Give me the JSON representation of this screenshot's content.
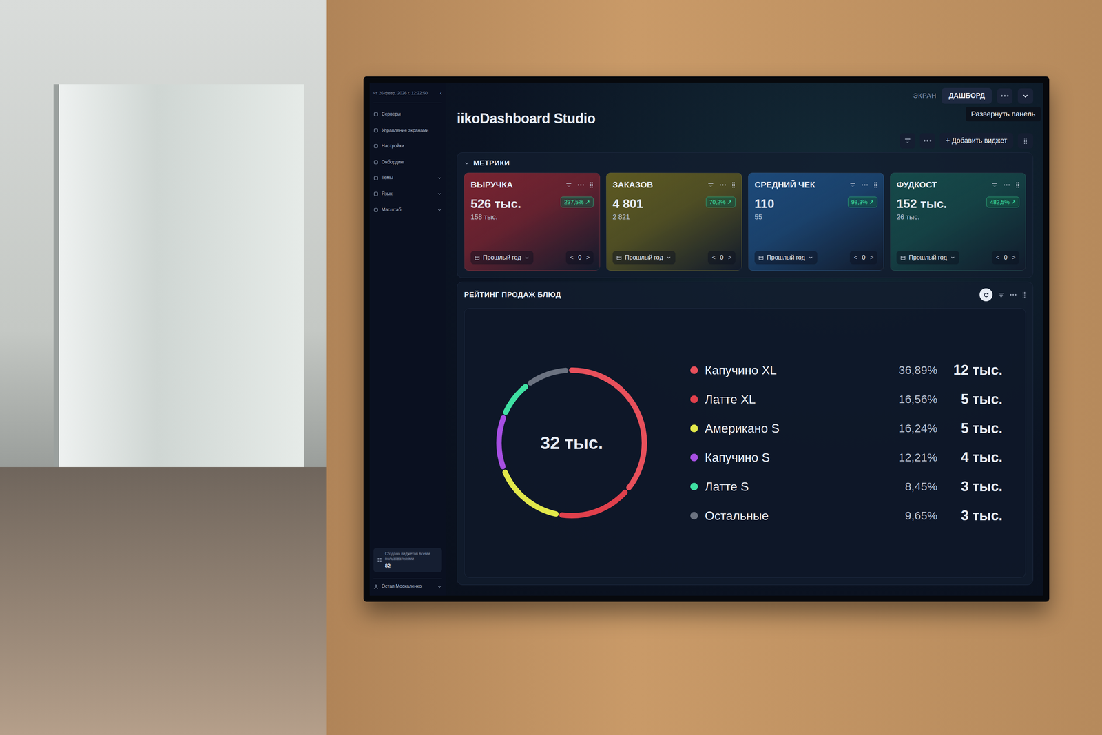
{
  "top_bar": {
    "screen_label": "ЭКРАН",
    "screen_value": "ДАШБОРД",
    "tooltip": "Развернуть панель"
  },
  "sidebar": {
    "datetime": "чт 26 февр. 2026 г. 12:22:50",
    "collapse": "‹",
    "items": [
      {
        "label": "Серверы",
        "expandable": false
      },
      {
        "label": "Управление экранами",
        "expandable": false
      },
      {
        "label": "Настройки",
        "expandable": false
      },
      {
        "label": "Онбординг",
        "expandable": false
      },
      {
        "label": "Темы",
        "expandable": true
      },
      {
        "label": "Язык",
        "expandable": true
      },
      {
        "label": "Масштаб",
        "expandable": true
      }
    ],
    "widgets_stat": {
      "label": "Создано виджетов всеми пользователями",
      "count": "82"
    },
    "user": "Остап Москаленко"
  },
  "header": {
    "title": "iikoDashboard Studio",
    "add_widget": "+ Добавить виджет"
  },
  "metrics": {
    "title": "МЕТРИКИ",
    "expanded": true,
    "cards": [
      {
        "title": "ВЫРУЧКА",
        "value": "526 тыс.",
        "previous": "158 тыс.",
        "delta": "237,5% ↗",
        "period": "Прошлый год",
        "offset": "0",
        "prev": "<",
        "next": ">",
        "color": "#7a2431"
      },
      {
        "title": "ЗАКАЗОВ",
        "value": "4 801",
        "previous": "2 821",
        "delta": "70,2% ↗",
        "period": "Прошлый год",
        "offset": "0",
        "prev": "<",
        "next": ">",
        "color": "#5e5a22"
      },
      {
        "title": "СРЕДНИЙ ЧЕК",
        "value": "110",
        "previous": "55",
        "delta": "98,3% ↗",
        "period": "Прошлый год",
        "offset": "0",
        "prev": "<",
        "next": ">",
        "color": "#1d4a7a"
      },
      {
        "title": "ФУДКОСТ",
        "value": "152 тыс.",
        "previous": "26 тыс.",
        "delta": "482,5% ↗",
        "period": "Прошлый год",
        "offset": "0",
        "prev": "<",
        "next": ">",
        "color": "#164a4a"
      }
    ]
  },
  "rating": {
    "title": "РЕЙТИНГ ПРОДАЖ БЛЮД",
    "chart": {
      "center": "32 тыс.",
      "values": [
        36.89,
        16.56,
        16.24,
        12.21,
        8.45,
        9.65
      ]
    },
    "items": [
      {
        "name": "Капучино XL",
        "percent": "36,89%",
        "value": "12 тыс.",
        "color": "#e8505b"
      },
      {
        "name": "Латте XL",
        "percent": "16,56%",
        "value": "5 тыс.",
        "color": "#e0404c"
      },
      {
        "name": "Американо S",
        "percent": "16,24%",
        "value": "5 тыс.",
        "color": "#e2e84a"
      },
      {
        "name": "Капучино S",
        "percent": "12,21%",
        "value": "4 тыс.",
        "color": "#a64fe2"
      },
      {
        "name": "Латте S",
        "percent": "8,45%",
        "value": "3 тыс.",
        "color": "#3fe0a2"
      },
      {
        "name": "Остальные",
        "percent": "9,65%",
        "value": "3 тыс.",
        "color": "#6b7280"
      }
    ]
  }
}
